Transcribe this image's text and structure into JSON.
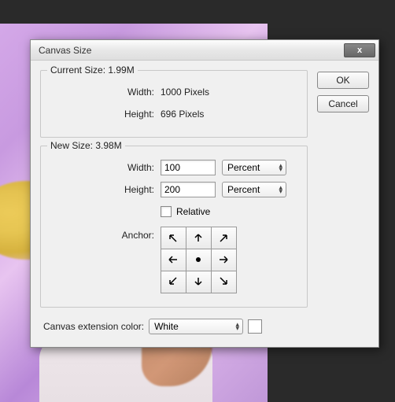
{
  "dialog": {
    "title": "Canvas Size",
    "close_label": "x"
  },
  "buttons": {
    "ok": "OK",
    "cancel": "Cancel"
  },
  "current": {
    "legend": "Current Size:",
    "size": "1.99M",
    "width_label": "Width:",
    "width_value": "1000 Pixels",
    "height_label": "Height:",
    "height_value": "696 Pixels"
  },
  "new": {
    "legend": "New Size:",
    "size": "3.98M",
    "width_label": "Width:",
    "width_value": "100",
    "width_unit": "Percent",
    "height_label": "Height:",
    "height_value": "200",
    "height_unit": "Percent",
    "relative_label": "Relative",
    "relative_checked": false,
    "anchor_label": "Anchor:",
    "anchor_position": "center"
  },
  "extension": {
    "label": "Canvas extension color:",
    "value": "White",
    "swatch_color": "#ffffff"
  }
}
